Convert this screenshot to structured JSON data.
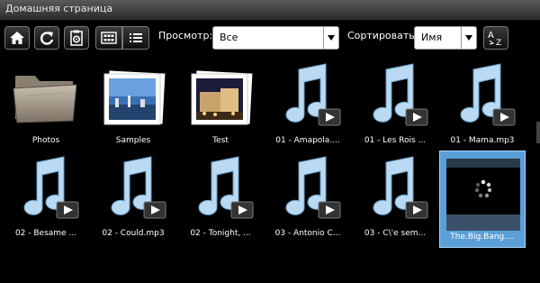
{
  "window": {
    "title": "Домашняя страница"
  },
  "toolbar": {
    "home_icon": "home-icon",
    "refresh_icon": "refresh-icon",
    "settings_icon": "settings-icon",
    "grid_view_icon": "grid-view-icon",
    "list_view_icon": "list-view-icon",
    "view_label": "Просмотр:",
    "view_value": "Все",
    "sort_label": "Сортировать:",
    "sort_value": "Имя",
    "sort_az_icon": "sort-az-icon"
  },
  "colors": {
    "background": "#000000",
    "selection": "#5b9fd8",
    "music_note": "#b9daf2"
  },
  "items": [
    {
      "name": "Photos",
      "type": "folder"
    },
    {
      "name": "Samples",
      "type": "photo-folder"
    },
    {
      "name": "Test",
      "type": "photo-folder"
    },
    {
      "name": "01 - Amapola....",
      "type": "music"
    },
    {
      "name": "01 - Les Rois ...",
      "type": "music"
    },
    {
      "name": "01 - Mama.mp3",
      "type": "music"
    },
    {
      "name": "02 - Besame ...",
      "type": "music"
    },
    {
      "name": "02 - Could.mp3",
      "type": "music"
    },
    {
      "name": "02 - Tonight, ...",
      "type": "music"
    },
    {
      "name": "03 - Antonio C...",
      "type": "music"
    },
    {
      "name": "03 - C\\'e sem...",
      "type": "music"
    },
    {
      "name": "The.Big.Bang....",
      "type": "video",
      "selected": true
    }
  ]
}
